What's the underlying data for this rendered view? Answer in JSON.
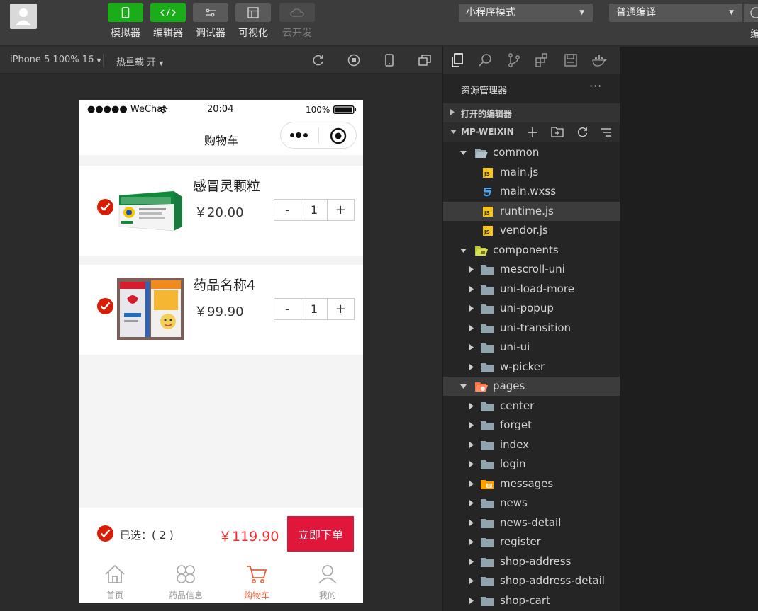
{
  "toolbar": {
    "tools": [
      {
        "label": "模拟器",
        "icon": "phone-icon",
        "style": "green"
      },
      {
        "label": "编辑器",
        "icon": "code-icon",
        "style": "green"
      },
      {
        "label": "调试器",
        "icon": "debug-icon",
        "style": "gray"
      },
      {
        "label": "可视化",
        "icon": "layout-icon",
        "style": "gray"
      },
      {
        "label": "云开发",
        "icon": "cloud-icon",
        "style": "dim"
      }
    ],
    "mode_select": "小程序模式",
    "compile_select": "普通编译",
    "edge_label": "编"
  },
  "simulator": {
    "device": "iPhone 5 100% 16",
    "hot_reload": "热重载 开"
  },
  "phone": {
    "carrier": "●●●●● WeChat",
    "time": "20:04",
    "battery": "100%",
    "page_title": "购物车",
    "items": [
      {
        "name": "感冒灵颗粒",
        "price": "￥20.00",
        "qty": "1",
        "checked": true
      },
      {
        "name": "药品名称4",
        "price": "￥99.90",
        "qty": "1",
        "checked": true
      }
    ],
    "stepper_minus": "-",
    "stepper_plus": "+",
    "selected_text": "已选：( 2 )",
    "total": "￥119.90",
    "checkout_label": "立即下单",
    "tabs": [
      {
        "label": "首页",
        "icon": "home-icon",
        "active": false
      },
      {
        "label": "药品信息",
        "icon": "clover-icon",
        "active": false
      },
      {
        "label": "购物车",
        "icon": "cart-icon",
        "active": true
      },
      {
        "label": "我的",
        "icon": "person-icon",
        "active": false
      }
    ]
  },
  "explorer": {
    "title": "资源管理器",
    "more": "···",
    "open_editors": "打开的编辑器",
    "project": "MP-WEIXIN",
    "tree": [
      {
        "label": "common",
        "type": "folder-open",
        "depth": 0
      },
      {
        "label": "main.js",
        "type": "js",
        "depth": 1
      },
      {
        "label": "main.wxss",
        "type": "css",
        "depth": 1
      },
      {
        "label": "runtime.js",
        "type": "js",
        "depth": 1,
        "selected": true
      },
      {
        "label": "vendor.js",
        "type": "js",
        "depth": 1
      },
      {
        "label": "components",
        "type": "folder-open-special",
        "depth": 0
      },
      {
        "label": "mescroll-uni",
        "type": "folder",
        "depth": 1
      },
      {
        "label": "uni-load-more",
        "type": "folder",
        "depth": 1
      },
      {
        "label": "uni-popup",
        "type": "folder",
        "depth": 1
      },
      {
        "label": "uni-transition",
        "type": "folder",
        "depth": 1
      },
      {
        "label": "uni-ui",
        "type": "folder",
        "depth": 1
      },
      {
        "label": "w-picker",
        "type": "folder",
        "depth": 1
      },
      {
        "label": "pages",
        "type": "folder-open-pages",
        "depth": 0,
        "selected": true
      },
      {
        "label": "center",
        "type": "folder",
        "depth": 1
      },
      {
        "label": "forget",
        "type": "folder",
        "depth": 1
      },
      {
        "label": "index",
        "type": "folder",
        "depth": 1
      },
      {
        "label": "login",
        "type": "folder",
        "depth": 1
      },
      {
        "label": "messages",
        "type": "folder-messages",
        "depth": 1
      },
      {
        "label": "news",
        "type": "folder",
        "depth": 1
      },
      {
        "label": "news-detail",
        "type": "folder",
        "depth": 1
      },
      {
        "label": "register",
        "type": "folder",
        "depth": 1
      },
      {
        "label": "shop-address",
        "type": "folder",
        "depth": 1
      },
      {
        "label": "shop-address-detail",
        "type": "folder",
        "depth": 1
      },
      {
        "label": "shop-cart",
        "type": "folder",
        "depth": 1
      }
    ]
  },
  "colors": {
    "accent_green": "#1aad19",
    "brand_red": "#d81e06",
    "checkout_red": "#e0163b",
    "price_red": "#f23030"
  }
}
